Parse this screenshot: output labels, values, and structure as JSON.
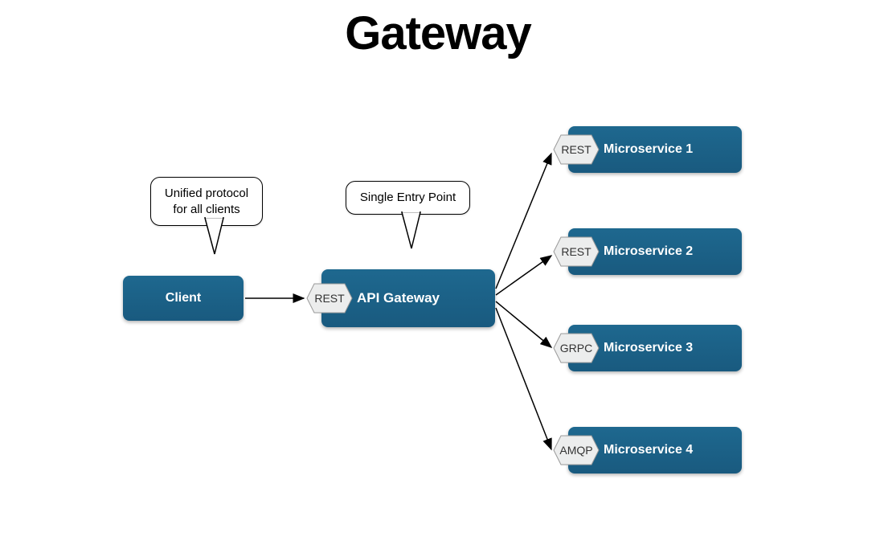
{
  "title": "Gateway",
  "nodes": {
    "client": "Client",
    "gateway": "API Gateway",
    "ms1": "Microservice 1",
    "ms2": "Microservice 2",
    "ms3": "Microservice 3",
    "ms4": "Microservice 4"
  },
  "protocols": {
    "gateway": "REST",
    "ms1": "REST",
    "ms2": "REST",
    "ms3": "GRPC",
    "ms4": "AMQP"
  },
  "callouts": {
    "unified": "Unified protocol\nfor all clients",
    "entry": "Single Entry Point"
  }
}
